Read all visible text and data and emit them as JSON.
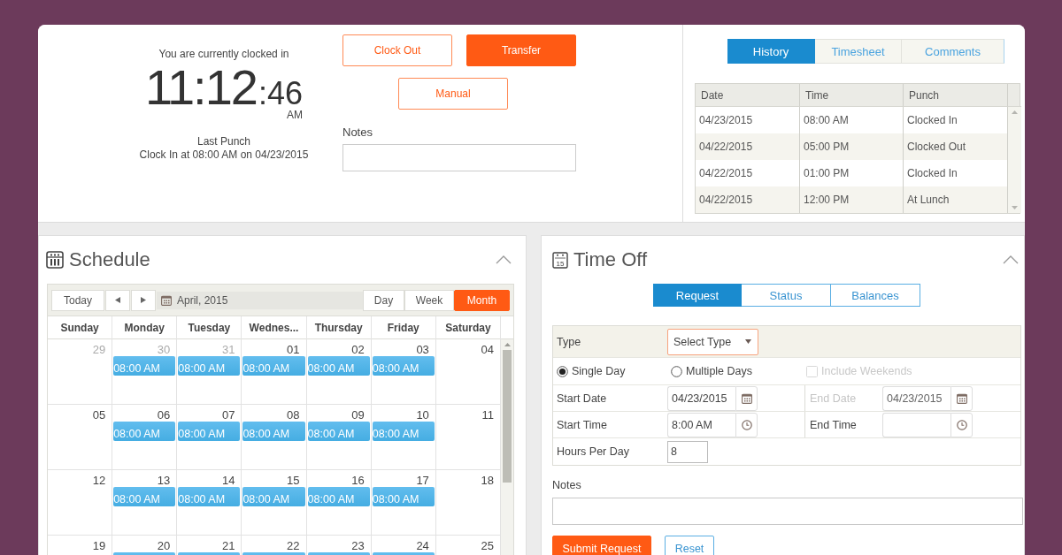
{
  "clock": {
    "status": "You are currently clocked in",
    "hours_minutes": "11:12",
    "seconds": ":46",
    "meridiem": "AM",
    "last_punch_label": "Last Punch",
    "last_punch": "Clock In at 08:00 AM on 04/23/2015"
  },
  "punch_buttons": [
    {
      "label": "Clock Out",
      "kind": "outline"
    },
    {
      "label": "Transfer",
      "kind": "filled"
    },
    {
      "label": "Manual",
      "kind": "outline"
    }
  ],
  "notes": {
    "label": "Notes"
  },
  "history": {
    "tabs": [
      {
        "label": "History",
        "selected": true
      },
      {
        "label": "Timesheet",
        "selected": false
      },
      {
        "label": "Comments",
        "selected": false
      }
    ],
    "columns": [
      "Date",
      "Time",
      "Punch"
    ],
    "rows": [
      [
        "04/23/2015",
        "08:00 AM",
        "Clocked In"
      ],
      [
        "04/22/2015",
        "05:00 PM",
        "Clocked Out"
      ],
      [
        "04/22/2015",
        "01:00 PM",
        "Clocked In"
      ],
      [
        "04/22/2015",
        "12:00 PM",
        "At Lunch"
      ]
    ]
  },
  "schedule": {
    "title": "Schedule",
    "expanded": true,
    "today": "Today",
    "period": "April, 2015",
    "views": [
      {
        "label": "Day",
        "selected": false
      },
      {
        "label": "Week",
        "selected": false
      },
      {
        "label": "Month",
        "selected": true
      }
    ],
    "weekdays": [
      "Sunday",
      "Monday",
      "Tuesday",
      "Wednes...",
      "Thursday",
      "Friday",
      "Saturday"
    ],
    "weeks": [
      [
        {
          "day": "29",
          "muted": true,
          "has_event": false
        },
        {
          "day": "30",
          "muted": true,
          "has_event": true,
          "event": "08:00 AM"
        },
        {
          "day": "31",
          "muted": true,
          "has_event": true,
          "event": "08:00 AM"
        },
        {
          "day": "01",
          "muted": false,
          "has_event": true,
          "event": "08:00 AM"
        },
        {
          "day": "02",
          "muted": false,
          "has_event": true,
          "event": "08:00 AM"
        },
        {
          "day": "03",
          "muted": false,
          "has_event": true,
          "event": "08:00 AM"
        },
        {
          "day": "04",
          "muted": false,
          "has_event": false
        }
      ],
      [
        {
          "day": "05",
          "muted": false,
          "has_event": false
        },
        {
          "day": "06",
          "muted": false,
          "has_event": true,
          "event": "08:00 AM"
        },
        {
          "day": "07",
          "muted": false,
          "has_event": true,
          "event": "08:00 AM"
        },
        {
          "day": "08",
          "muted": false,
          "has_event": true,
          "event": "08:00 AM"
        },
        {
          "day": "09",
          "muted": false,
          "has_event": true,
          "event": "08:00 AM"
        },
        {
          "day": "10",
          "muted": false,
          "has_event": true,
          "event": "08:00 AM"
        },
        {
          "day": "11",
          "muted": false,
          "has_event": false
        }
      ],
      [
        {
          "day": "12",
          "muted": false,
          "has_event": false
        },
        {
          "day": "13",
          "muted": false,
          "has_event": true,
          "event": "08:00 AM"
        },
        {
          "day": "14",
          "muted": false,
          "has_event": true,
          "event": "08:00 AM"
        },
        {
          "day": "15",
          "muted": false,
          "has_event": true,
          "event": "08:00 AM"
        },
        {
          "day": "16",
          "muted": false,
          "has_event": true,
          "event": "08:00 AM"
        },
        {
          "day": "17",
          "muted": false,
          "has_event": true,
          "event": "08:00 AM"
        },
        {
          "day": "18",
          "muted": false,
          "has_event": false
        }
      ],
      [
        {
          "day": "19",
          "muted": false,
          "has_event": false
        },
        {
          "day": "20",
          "muted": false,
          "has_event": true
        },
        {
          "day": "21",
          "muted": false,
          "has_event": true
        },
        {
          "day": "22",
          "muted": false,
          "has_event": true
        },
        {
          "day": "23",
          "muted": false,
          "has_event": true
        },
        {
          "day": "24",
          "muted": false,
          "has_event": true
        },
        {
          "day": "25",
          "muted": false,
          "has_event": false
        }
      ]
    ]
  },
  "time_off": {
    "title": "Time Off",
    "icon_day": "15",
    "expanded": true,
    "tabs": [
      {
        "label": "Request",
        "selected": true
      },
      {
        "label": "Status",
        "selected": false
      },
      {
        "label": "Balances",
        "selected": false
      }
    ],
    "type": {
      "label": "Type",
      "value": "Select Type",
      "focused": true
    },
    "duration": [
      {
        "label": "Single Day",
        "selected": true
      },
      {
        "label": "Multiple Days",
        "selected": false
      }
    ],
    "include_weekends": {
      "label": "Include Weekends",
      "checked": false,
      "disabled": true
    },
    "start_date": {
      "label": "Start Date",
      "value": "04/23/2015",
      "disabled": false
    },
    "end_date": {
      "label": "End Date",
      "value": "04/23/2015",
      "disabled": true
    },
    "start_time": {
      "label": "Start Time",
      "value": "8:00 AM"
    },
    "end_time": {
      "label": "End Time"
    },
    "hours_per_day": {
      "label": "Hours Per Day",
      "value": "8"
    },
    "notes": {
      "label": "Notes"
    },
    "buttons": [
      {
        "label": "Submit Request",
        "kind": "filled"
      },
      {
        "label": "Reset",
        "kind": "outline"
      }
    ]
  }
}
